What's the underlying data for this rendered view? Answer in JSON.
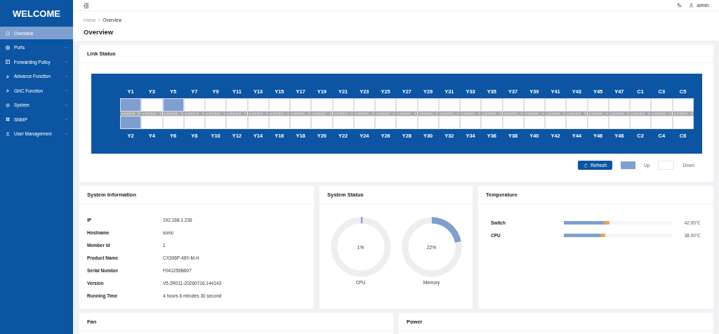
{
  "sidebar": {
    "title": "WELCOME",
    "items": [
      {
        "label": "Overview",
        "selected": true,
        "expandable": false
      },
      {
        "label": "Ports",
        "selected": false,
        "expandable": true
      },
      {
        "label": "Forwarding Policy",
        "selected": false,
        "expandable": true
      },
      {
        "label": "Advance Function",
        "selected": false,
        "expandable": true
      },
      {
        "label": "GHC Function",
        "selected": false,
        "expandable": true
      },
      {
        "label": "System",
        "selected": false,
        "expandable": true
      },
      {
        "label": "SNMP",
        "selected": false,
        "expandable": true
      },
      {
        "label": "User Management",
        "selected": false,
        "expandable": true
      }
    ]
  },
  "header": {
    "user": "admin"
  },
  "breadcrumb": {
    "separator": "/",
    "items": [
      "Home",
      "Overview"
    ]
  },
  "page_title": "Overview",
  "link_status": {
    "title": "Link Status",
    "ports": [
      {
        "top": {
          "label": "Y1",
          "up": true
        },
        "bottom": {
          "label": "Y2",
          "up": true
        }
      },
      {
        "top": {
          "label": "Y3",
          "up": false
        },
        "bottom": {
          "label": "Y4",
          "up": false
        }
      },
      {
        "top": {
          "label": "Y5",
          "up": true
        },
        "bottom": {
          "label": "Y6",
          "up": false
        }
      },
      {
        "top": {
          "label": "Y7",
          "up": false
        },
        "bottom": {
          "label": "Y8",
          "up": false
        }
      },
      {
        "top": {
          "label": "Y9",
          "up": false
        },
        "bottom": {
          "label": "Y10",
          "up": false
        }
      },
      {
        "top": {
          "label": "Y11",
          "up": false
        },
        "bottom": {
          "label": "Y12",
          "up": false
        }
      },
      {
        "top": {
          "label": "Y13",
          "up": false
        },
        "bottom": {
          "label": "Y14",
          "up": false
        }
      },
      {
        "top": {
          "label": "Y15",
          "up": false
        },
        "bottom": {
          "label": "Y16",
          "up": false
        }
      },
      {
        "top": {
          "label": "Y17",
          "up": false
        },
        "bottom": {
          "label": "Y18",
          "up": false
        }
      },
      {
        "top": {
          "label": "Y19",
          "up": false
        },
        "bottom": {
          "label": "Y20",
          "up": false
        }
      },
      {
        "top": {
          "label": "Y21",
          "up": false
        },
        "bottom": {
          "label": "Y22",
          "up": false
        }
      },
      {
        "top": {
          "label": "Y23",
          "up": false
        },
        "bottom": {
          "label": "Y24",
          "up": false
        }
      },
      {
        "top": {
          "label": "Y25",
          "up": false
        },
        "bottom": {
          "label": "Y26",
          "up": false
        }
      },
      {
        "top": {
          "label": "Y27",
          "up": false
        },
        "bottom": {
          "label": "Y28",
          "up": false
        }
      },
      {
        "top": {
          "label": "Y29",
          "up": false
        },
        "bottom": {
          "label": "Y30",
          "up": false
        }
      },
      {
        "top": {
          "label": "Y31",
          "up": false
        },
        "bottom": {
          "label": "Y32",
          "up": false
        }
      },
      {
        "top": {
          "label": "Y33",
          "up": false
        },
        "bottom": {
          "label": "Y34",
          "up": false
        }
      },
      {
        "top": {
          "label": "Y35",
          "up": false
        },
        "bottom": {
          "label": "Y36",
          "up": false
        }
      },
      {
        "top": {
          "label": "Y37",
          "up": false
        },
        "bottom": {
          "label": "Y38",
          "up": false
        }
      },
      {
        "top": {
          "label": "Y39",
          "up": false
        },
        "bottom": {
          "label": "Y40",
          "up": false
        }
      },
      {
        "top": {
          "label": "Y41",
          "up": false
        },
        "bottom": {
          "label": "Y42",
          "up": false
        }
      },
      {
        "top": {
          "label": "Y43",
          "up": false
        },
        "bottom": {
          "label": "Y44",
          "up": false
        }
      },
      {
        "top": {
          "label": "Y45",
          "up": false
        },
        "bottom": {
          "label": "Y46",
          "up": false
        }
      },
      {
        "top": {
          "label": "Y47",
          "up": false
        },
        "bottom": {
          "label": "Y48",
          "up": false
        }
      },
      {
        "top": {
          "label": "C1",
          "up": false
        },
        "bottom": {
          "label": "C2",
          "up": false
        }
      },
      {
        "top": {
          "label": "C3",
          "up": false
        },
        "bottom": {
          "label": "C4",
          "up": false
        }
      },
      {
        "top": {
          "label": "C5",
          "up": false
        },
        "bottom": {
          "label": "C6",
          "up": false
        }
      }
    ],
    "refresh_button": "Refresh",
    "legend": {
      "up": "Up",
      "down": "Down"
    }
  },
  "system_information": {
    "title": "System Information",
    "rows": [
      {
        "label": "IP",
        "value": "192.168.1.236"
      },
      {
        "label": "Hostname",
        "value": "sonic"
      },
      {
        "label": "Member Id",
        "value": "1"
      },
      {
        "label": "Product Name",
        "value": "CX306P-48Y-M-H"
      },
      {
        "label": "Serial Number",
        "value": "F041259B607"
      },
      {
        "label": "Version",
        "value": "V5.2R011-20260716.144143"
      },
      {
        "label": "Running Time",
        "value": "4 hours 6 minutes 30 second"
      }
    ]
  },
  "system_status": {
    "title": "System Status",
    "gauges": [
      {
        "name": "CPU",
        "reading": "1%"
      },
      {
        "name": "Memory",
        "reading": "22%"
      }
    ]
  },
  "temperature": {
    "title": "Temperature",
    "sensors": [
      {
        "name": "Switch",
        "reading": "42.00℃",
        "level": 0.42
      },
      {
        "name": "CPU",
        "reading": "38.00℃",
        "level": 0.38
      }
    ]
  },
  "fan": {
    "title": "Fan"
  },
  "power": {
    "title": "Power"
  }
}
